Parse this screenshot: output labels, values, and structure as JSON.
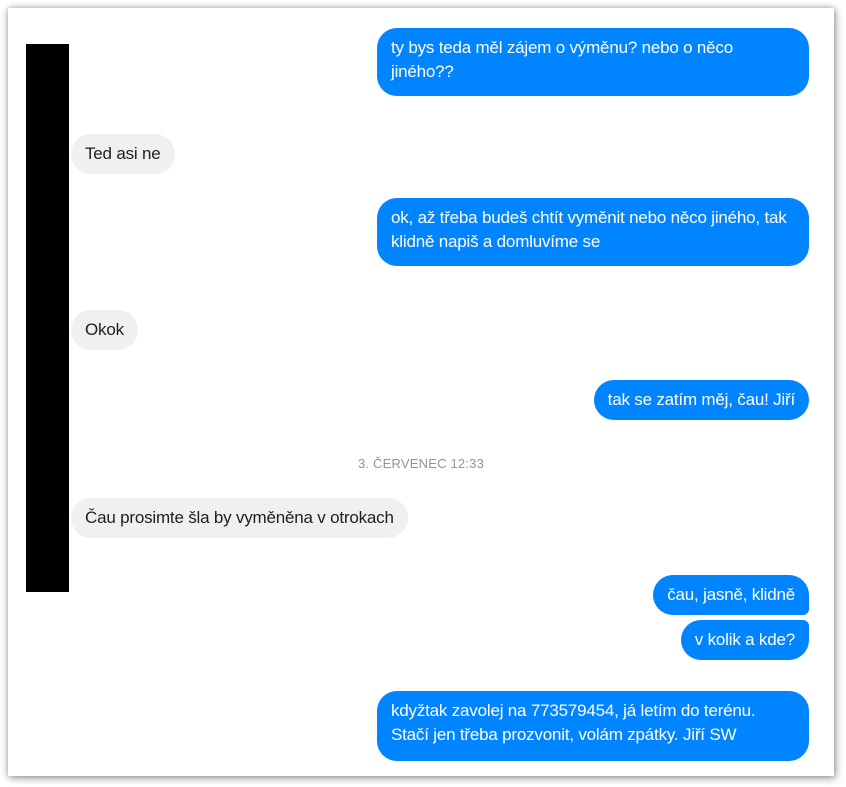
{
  "conversation": {
    "messages": [
      {
        "direction": "outgoing",
        "text": "ty bys teda měl zájem o výměnu? nebo o něco jiného??"
      },
      {
        "direction": "incoming",
        "text": "Ted asi ne"
      },
      {
        "direction": "outgoing",
        "text": "ok, až třeba budeš chtít vyměnit nebo něco jiného, tak klidně napiš a domluvíme se"
      },
      {
        "direction": "incoming",
        "text": "Okok"
      },
      {
        "direction": "outgoing",
        "text": "tak se zatím měj, čau! Jiří"
      },
      {
        "direction": "timestamp",
        "text": "3. ČERVENEC 12:33"
      },
      {
        "direction": "incoming",
        "text": "Čau prosimte šla by vyměněna v otrokach"
      },
      {
        "direction": "outgoing",
        "text": "čau, jasně, klidně"
      },
      {
        "direction": "outgoing",
        "text": "v kolik a kde?"
      },
      {
        "direction": "outgoing",
        "text": "kdyžtak zavolej na 773579454, já letím do terénu. Stačí jen třeba prozvonit, volám zpátky. Jiří SW"
      }
    ]
  },
  "colors": {
    "outgoing_bubble": "#0084ff",
    "incoming_bubble": "#f1f0f0",
    "timestamp_text": "#90949c",
    "redaction": "#000000"
  }
}
